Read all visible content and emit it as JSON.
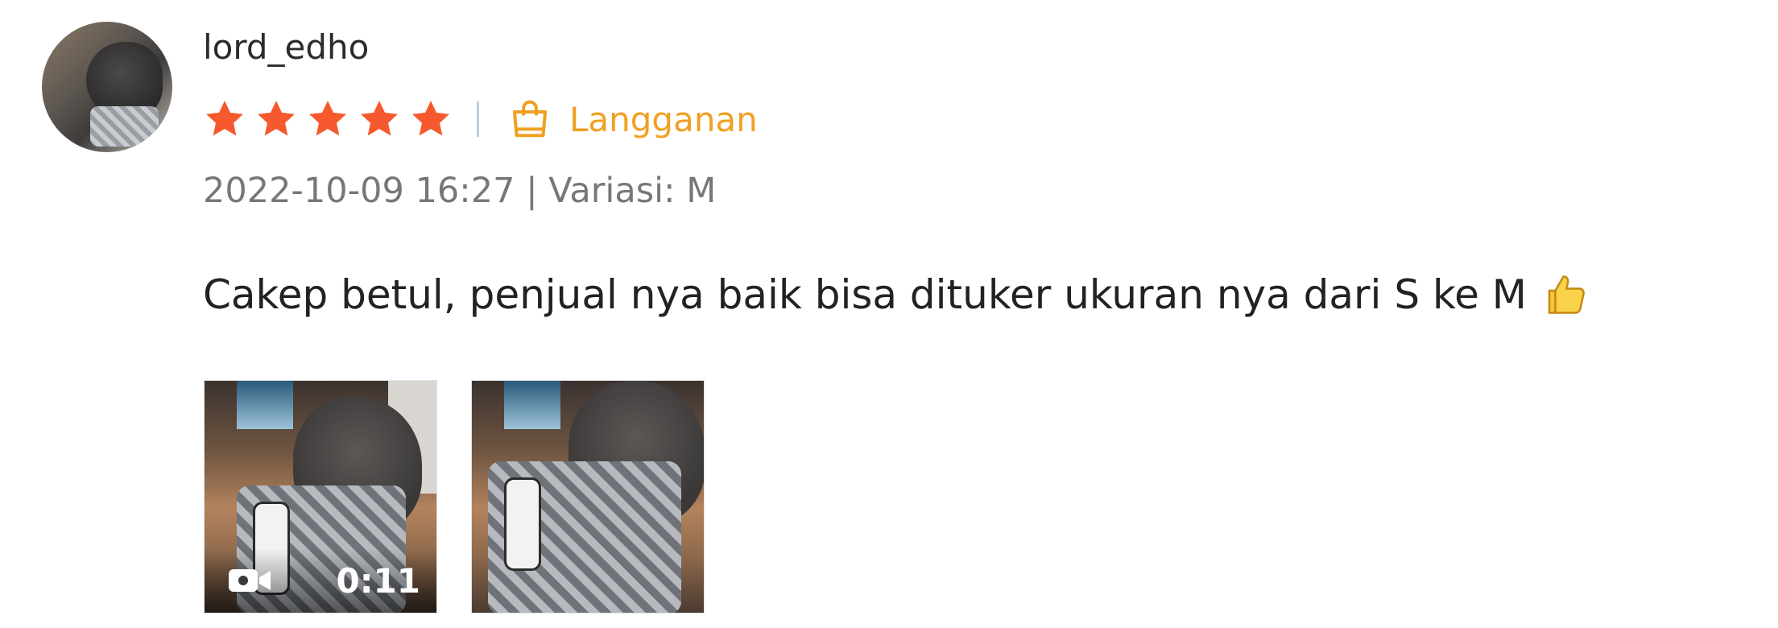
{
  "review": {
    "username": "lord_edho",
    "rating": 5,
    "rating_max": 5,
    "badge_label": "Langganan",
    "meta": "2022-10-09 16:27 | Variasi: M",
    "comment": "Cakep betul, penjual nya baik bisa dituker ukuran nya dari S ke M",
    "comment_emoji": "thumbs-up-icon",
    "media": [
      {
        "type": "video",
        "duration": "0:11"
      },
      {
        "type": "image"
      }
    ]
  },
  "colors": {
    "star": "#f6592e",
    "badge": "#f0a023",
    "divider": "#b9cfe0",
    "meta_text": "#777777"
  }
}
